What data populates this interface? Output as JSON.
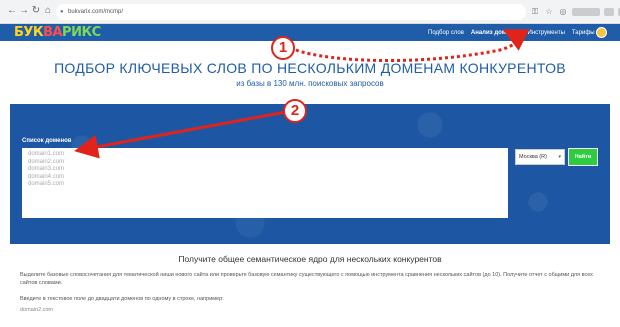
{
  "browser": {
    "back": "←",
    "forward": "→",
    "reload": "↻",
    "home": "⌂",
    "url": "bukvarix.com/mcmp/"
  },
  "header": {
    "logo_parts": [
      "БУК",
      "ВА",
      "РИКС"
    ],
    "menu": [
      "Подбор слов",
      "Анализ доменов",
      "Инструменты",
      "Тарифы"
    ]
  },
  "hero": {
    "title": "ПОДБОР КЛЮЧЕВЫХ СЛОВ ПО НЕСКОЛЬКИМ ДОМЕНАМ КОНКУРЕНТОВ",
    "subtitle": "из базы в 130 млн. поисковых запросов"
  },
  "form": {
    "domains_label": "Список доменов",
    "domains_placeholder": [
      "domain1.com",
      "domain2.com",
      "domain3.com",
      "domain4.com",
      "domain5.com"
    ],
    "region": "Москва (R)",
    "submit": "Найти"
  },
  "content": {
    "section_title": "Получите общее семантическое ядро для нескольких конкурентов",
    "paragraph1": "Выделите базовые словосочетания для тематической ниши нового сайта или проверьте базовую семантику существующего с помощью инструмента сравнения нескольких сайтов (до 10). Получите отчет с общими для всех сайтов словами.",
    "paragraph2": "Введите в текстовое поле до двадцати доменов по одному в строке, например:",
    "example": "domain2.com"
  },
  "annotations": {
    "badge1": "1",
    "badge2": "2",
    "accent_color": "#e2231a"
  }
}
